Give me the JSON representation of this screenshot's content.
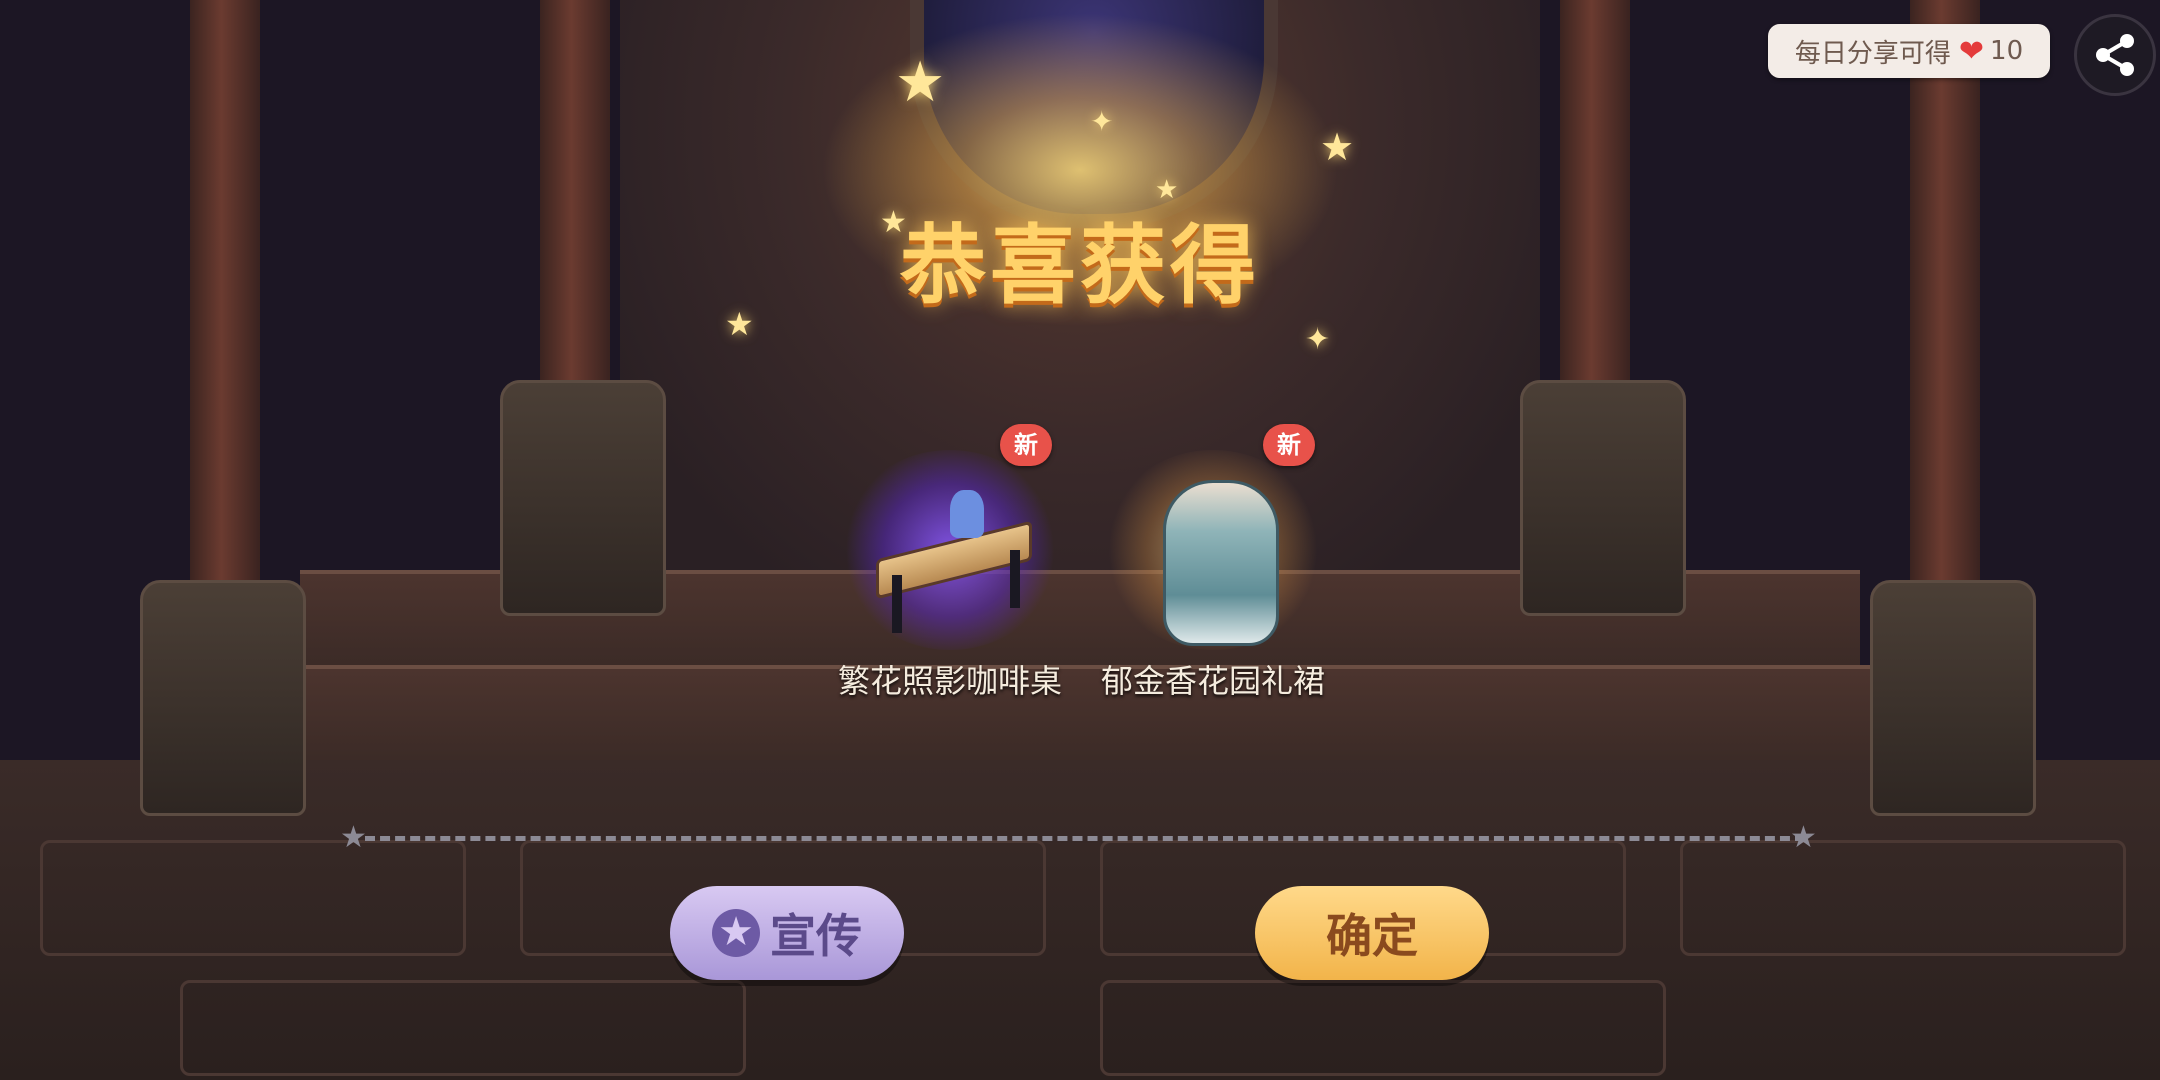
{
  "title": "恭喜获得",
  "items": [
    {
      "name": "繁花照影咖啡桌",
      "badge": "新",
      "icon": "coffee-table-icon"
    },
    {
      "name": "郁金香花园礼裙",
      "badge": "新",
      "icon": "dress-icon"
    }
  ],
  "buttons": {
    "promote_label": "宣传",
    "promote_icon": "star-badge-icon",
    "confirm_label": "确定"
  },
  "share": {
    "text": "每日分享可得",
    "reward_icon": "heart-icon",
    "reward_amount": "10",
    "share_icon": "share-icon"
  },
  "colors": {
    "title": "#ffd26a",
    "promote_button": "#c3b3ea",
    "confirm_button": "#f7c563",
    "badge": "#e8524a"
  }
}
